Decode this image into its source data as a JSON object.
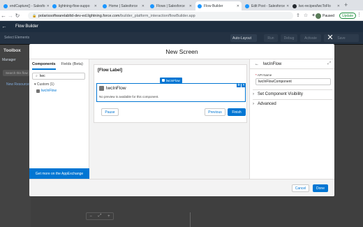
{
  "browser": {
    "tabs": [
      {
        "label": "endCapture() - Salesfo",
        "icon": "salesforce-icon"
      },
      {
        "label": "lightning-flow-suppo",
        "icon": "salesforce-icon"
      },
      {
        "label": "Home | Salesforce",
        "icon": "salesforce-icon"
      },
      {
        "label": "Flows | Salesforce",
        "icon": "salesforce-icon"
      },
      {
        "label": "Flow Builder",
        "icon": "salesforce-icon",
        "active": true
      },
      {
        "label": "Edit Post - Salesforce",
        "icon": "salesforce-icon"
      },
      {
        "label": "lwc-recipes/lwcToFlo",
        "icon": "github-icon"
      }
    ],
    "url_host": "polarissoftwarelabltd-dev-ed.lightning.force.com",
    "url_path": "/builder_platform_interaction/flowBuilder.app",
    "profile_label": "Paused",
    "update_label": "Update"
  },
  "app": {
    "header_title": "Flow Builder",
    "select_elements": "Select Elements",
    "auto_layout": "Auto-Layout",
    "toolbar_buttons": [
      "Run",
      "Debug",
      "Activate",
      "Save"
    ],
    "toolbox_title": "Toolbox",
    "manager_tab": "Manager",
    "search_placeholder": "Search this flow",
    "new_resource": "New Resource"
  },
  "modal": {
    "title": "New Screen",
    "left": {
      "tab_components": "Components",
      "tab_fields": "Fields (Beta)",
      "search_value": "lwc",
      "group_label": "Custom (1)",
      "item_label": "lwcInFlow",
      "appexchange": "Get more on the AppExchange"
    },
    "canvas": {
      "flow_label": "[Flow Label]",
      "badge": "lwcInFlow",
      "component_title": "lwcInFlow",
      "no_preview": "No preview is available for this component.",
      "pause": "Pause",
      "previous": "Previous",
      "finish": "Finish"
    },
    "props": {
      "title": "lwcInFlow",
      "api_label": "API Name",
      "api_value": "lwcInFlowComponent",
      "section_visibility": "Set Component Visibility",
      "section_advanced": "Advanced"
    },
    "footer": {
      "cancel": "Cancel",
      "done": "Done"
    }
  },
  "colors": {
    "brand": "#0176d3",
    "header": "#1d2d3f"
  }
}
